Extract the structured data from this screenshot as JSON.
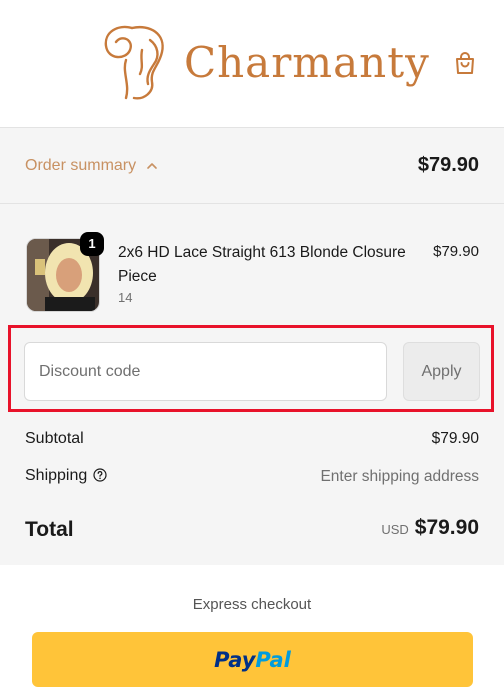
{
  "header": {
    "brand": "Charmanty"
  },
  "summary": {
    "toggle_label": "Order summary",
    "toggle_total": "$79.90"
  },
  "product": {
    "title": "2x6 HD Lace Straight 613 Blonde Closure Piece",
    "variant": "14",
    "quantity": "1",
    "price": "$79.90"
  },
  "discount": {
    "placeholder": "Discount code",
    "apply_label": "Apply"
  },
  "totals": {
    "subtotal_label": "Subtotal",
    "subtotal_value": "$79.90",
    "shipping_label": "Shipping",
    "shipping_value": "Enter shipping address",
    "total_label": "Total",
    "currency": "USD",
    "total_value": "$79.90"
  },
  "express": {
    "label": "Express checkout",
    "paypal_pay": "Pay",
    "paypal_pal": "Pal"
  },
  "colors": {
    "brand": "#c77a3b",
    "summary_accent": "#c89162",
    "highlight": "#e8122a",
    "paypal_yellow": "#ffc439",
    "paypal_dark_blue": "#003087",
    "paypal_light_blue": "#009cde"
  },
  "icons": [
    "brand-logo-icon",
    "shopping-bag-icon",
    "chevron-up-icon",
    "help-icon"
  ]
}
